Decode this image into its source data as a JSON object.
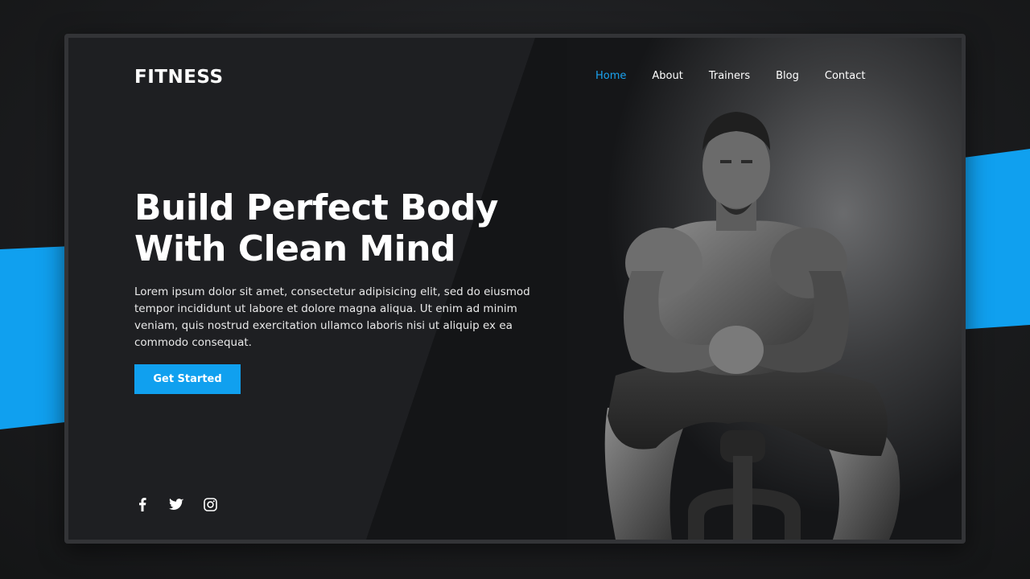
{
  "brand": {
    "logo_text": "FITNESS"
  },
  "nav": {
    "items": [
      {
        "label": "Home",
        "active": true
      },
      {
        "label": "About",
        "active": false
      },
      {
        "label": "Trainers",
        "active": false
      },
      {
        "label": "Blog",
        "active": false
      },
      {
        "label": "Contact",
        "active": false
      }
    ]
  },
  "hero": {
    "headline_line1": "Build Perfect Body",
    "headline_line2": "With Clean Mind",
    "description": "Lorem ipsum dolor sit amet, consectetur adipisicing elit, sed do eiusmod tempor incididunt ut labore et dolore magna aliqua. Ut enim ad minim veniam, quis nostrud exercitation ullamco laboris nisi ut aliquip ex ea commodo consequat.",
    "cta_label": "Get Started"
  },
  "social": {
    "icons": [
      "facebook-icon",
      "twitter-icon",
      "instagram-icon"
    ]
  },
  "colors": {
    "accent": "#10a0ef",
    "background": "#1e1f22",
    "text": "#ffffff"
  }
}
